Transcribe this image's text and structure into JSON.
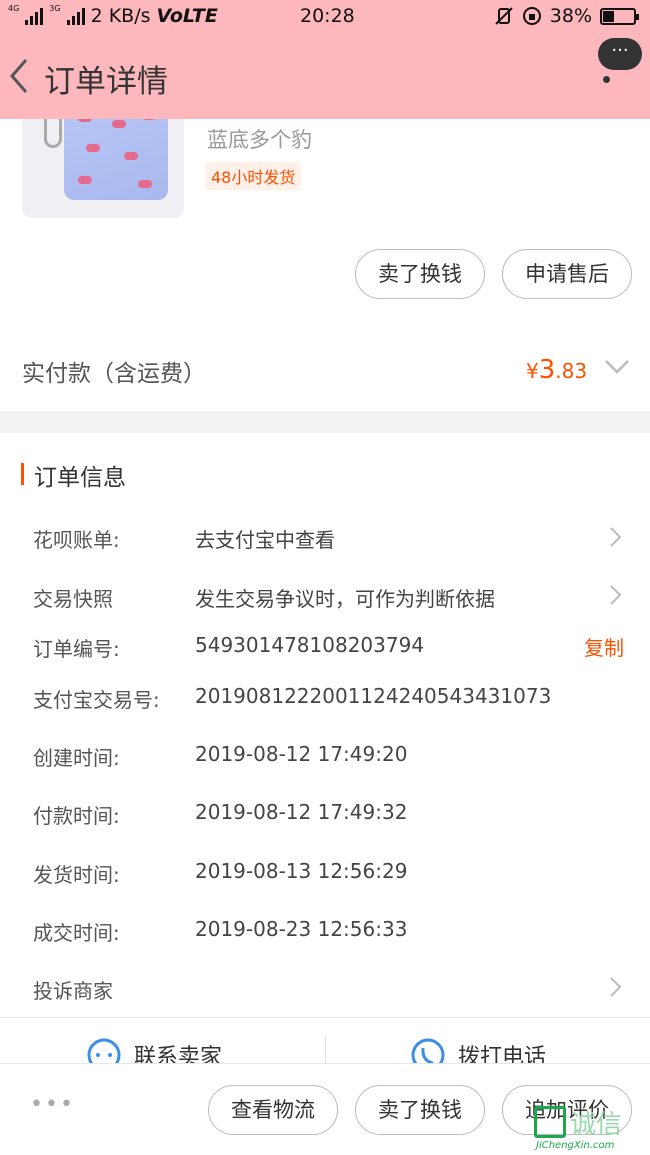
{
  "status_bar": {
    "network_top": "4G",
    "network_second": "3G",
    "speed": "2 KB/s",
    "volte": "VoLTE",
    "time": "20:28",
    "battery": "38%",
    "battery_level": 0.38
  },
  "nav": {
    "title": "订单详情",
    "more_label": "···"
  },
  "product": {
    "variant": "蓝底多个豹",
    "ship_tag": "48小时发货",
    "resell_label": "卖了换钱",
    "after_sale_label": "申请售后"
  },
  "payment": {
    "label": "实付款（含运费）",
    "currency": "¥",
    "amount_int": "3",
    "amount_dec": ".83"
  },
  "order_info": {
    "title": "订单信息",
    "rows": [
      {
        "label": "花呗账单:",
        "value": "去支付宝中查看"
      },
      {
        "label": "交易快照",
        "value": "发生交易争议时，可作为判断依据"
      },
      {
        "label": "订单编号:",
        "value": "549301478108203794"
      },
      {
        "label": "支付宝交易号:",
        "value": "2019081222001124240543431073"
      },
      {
        "label": "创建时间:",
        "value": "2019-08-12 17:49:20"
      },
      {
        "label": "付款时间:",
        "value": "2019-08-12 17:49:32"
      },
      {
        "label": "发货时间:",
        "value": "2019-08-13 12:56:29"
      },
      {
        "label": "成交时间:",
        "value": "2019-08-23 12:56:33"
      },
      {
        "label": "投诉商家",
        "value": ""
      }
    ],
    "copy_label": "复制",
    "contact_seller": "联系卖家",
    "call_phone": "拨打电话"
  },
  "bottom_bar": {
    "more": "•••",
    "logistics": "查看物流",
    "resell": "卖了换钱",
    "review": "追加评价"
  },
  "watermark": {
    "name": "诚信",
    "site": "JiChengXin.com"
  },
  "colors": {
    "accent": "#ff5000",
    "header_bg": "#fdb8bd"
  }
}
